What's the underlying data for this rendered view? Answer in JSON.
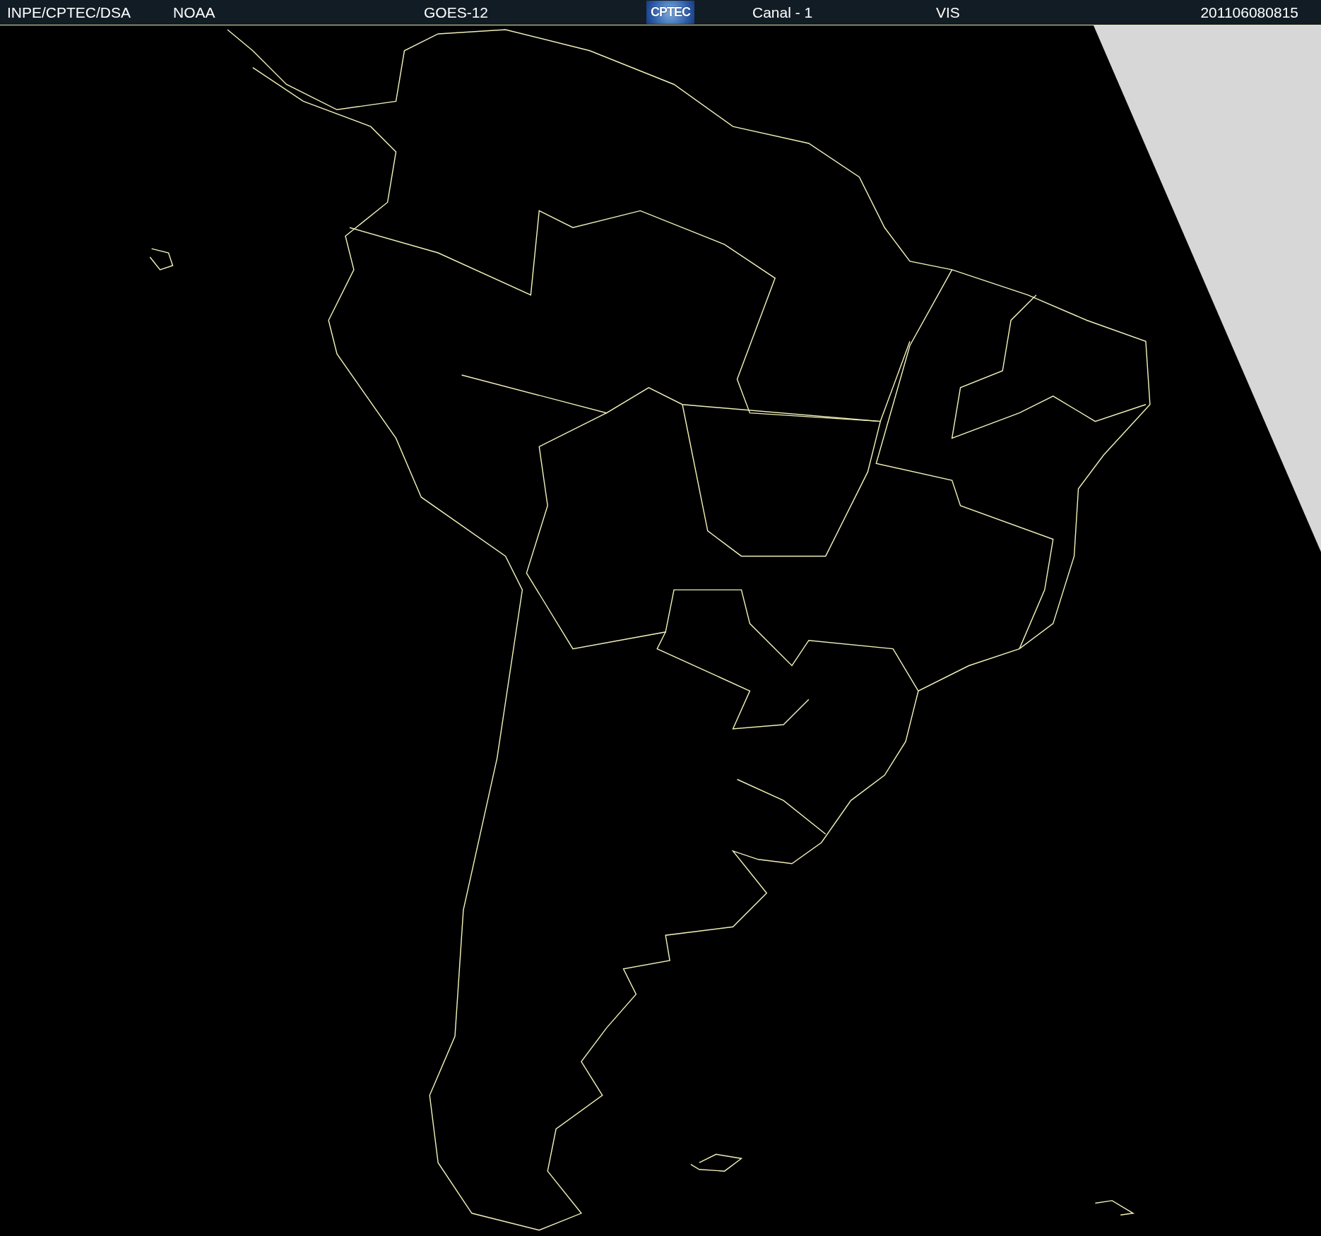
{
  "header": {
    "items": [
      {
        "kind": "text",
        "text": "INPE/CPTEC/DSA"
      },
      {
        "kind": "text",
        "text": "NOAA"
      },
      {
        "kind": "text",
        "text": "GOES-12"
      },
      {
        "kind": "logo",
        "text": "CPTEC"
      },
      {
        "kind": "text",
        "text": "Canal - 1"
      },
      {
        "kind": "text",
        "text": "VIS"
      },
      {
        "kind": "text",
        "text": "201106080815"
      }
    ]
  }
}
